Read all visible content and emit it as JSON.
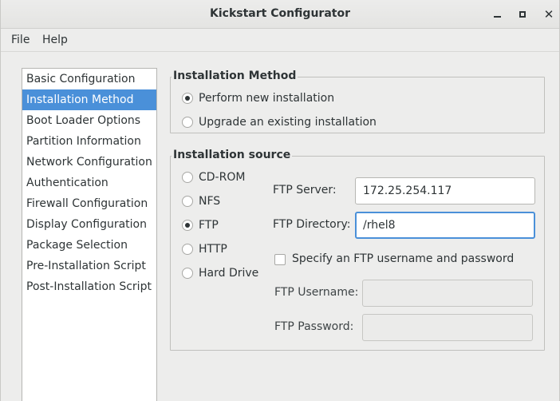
{
  "window": {
    "title": "Kickstart Configurator"
  },
  "menubar": {
    "file": "File",
    "help": "Help"
  },
  "sidebar": {
    "items": [
      {
        "label": "Basic Configuration"
      },
      {
        "label": "Installation Method",
        "selected": true
      },
      {
        "label": "Boot Loader Options"
      },
      {
        "label": "Partition Information"
      },
      {
        "label": "Network Configuration"
      },
      {
        "label": "Authentication"
      },
      {
        "label": "Firewall Configuration"
      },
      {
        "label": "Display Configuration"
      },
      {
        "label": "Package Selection"
      },
      {
        "label": "Pre-Installation Script"
      },
      {
        "label": "Post-Installation Script"
      }
    ]
  },
  "installation_method": {
    "heading": "Installation Method",
    "options": [
      {
        "label": "Perform new installation",
        "checked": true
      },
      {
        "label": "Upgrade an existing installation",
        "checked": false
      }
    ]
  },
  "installation_source": {
    "heading": "Installation source",
    "options": [
      {
        "label": "CD-ROM",
        "checked": false
      },
      {
        "label": "NFS",
        "checked": false
      },
      {
        "label": "FTP",
        "checked": true
      },
      {
        "label": "HTTP",
        "checked": false
      },
      {
        "label": "Hard Drive",
        "checked": false
      }
    ],
    "ftp_server_label": "FTP Server:",
    "ftp_server_value": "172.25.254.117",
    "ftp_directory_label": "FTP Directory:",
    "ftp_directory_value": "/rhel8",
    "ftp_auth_checkbox_label": "Specify an FTP username and password",
    "ftp_auth_checked": false,
    "ftp_username_label": "FTP Username:",
    "ftp_username_value": "",
    "ftp_password_label": "FTP Password:",
    "ftp_password_value": ""
  },
  "colors": {
    "selection": "#4a90d9",
    "focus_ring": "#4a90d9"
  }
}
